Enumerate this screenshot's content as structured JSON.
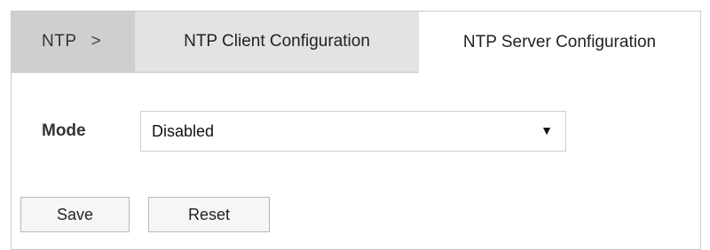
{
  "breadcrumb": {
    "root": "NTP",
    "separator": ">"
  },
  "tabs": [
    {
      "label": "NTP Client Configuration",
      "active": false
    },
    {
      "label": "NTP Server Configuration",
      "active": true
    }
  ],
  "form": {
    "mode_label": "Mode",
    "mode_value": "Disabled",
    "dropdown_arrow": "▼"
  },
  "buttons": {
    "save_label": "Save",
    "reset_label": "Reset"
  },
  "icons": {
    "dropdown": "triangle-down-icon"
  },
  "colors": {
    "tabbar_bg": "#cfcfcf",
    "inactive_tab_bg": "#e3e3e3",
    "active_tab_bg": "#ffffff",
    "border": "#c9c9c9"
  }
}
